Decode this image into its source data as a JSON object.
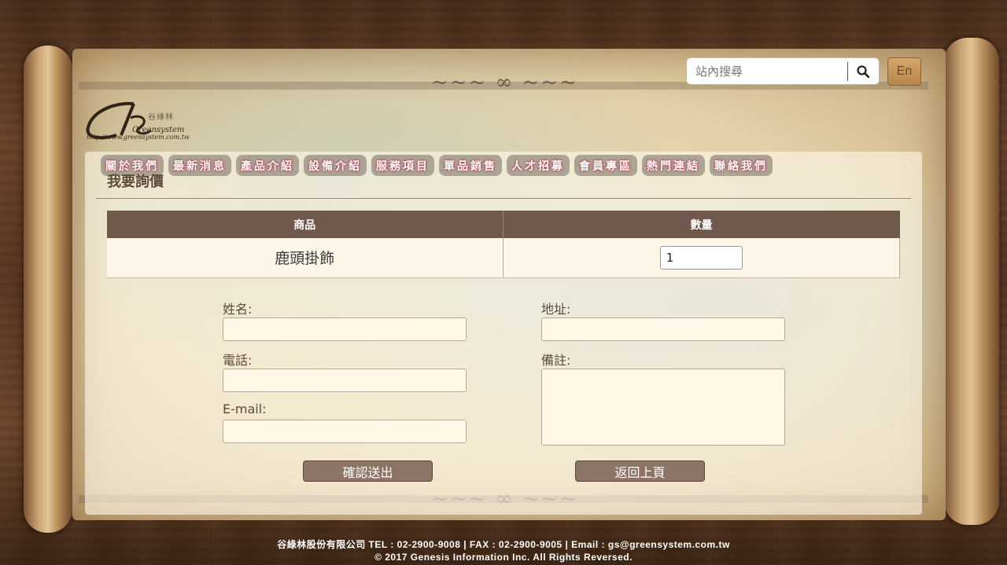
{
  "header": {
    "search_placeholder": "站內搜尋",
    "search_icon": "search-icon",
    "lang_label": "En",
    "logo": {
      "url_text": "http://www.greensystem.com.tw",
      "name_text": "Greensystem",
      "cn_text": "谷綠林"
    }
  },
  "nav": {
    "items": [
      "關於我們",
      "最新消息",
      "產品介紹",
      "設備介紹",
      "服務項目",
      "單品銷售",
      "人才招募",
      "會員專區",
      "熱門連結",
      "聯絡我們"
    ]
  },
  "page": {
    "title": "我要詢價"
  },
  "table": {
    "headers": [
      "商品",
      "數量"
    ],
    "rows": [
      {
        "product": "鹿頭掛飾",
        "quantity": "1"
      }
    ]
  },
  "form": {
    "name_label": "姓名:",
    "phone_label": "電話:",
    "email_label": "E-mail:",
    "address_label": "地址:",
    "note_label": "備註:",
    "submit_label": "確認送出",
    "back_label": "返回上頁"
  },
  "footer": {
    "line1": "谷綠林股份有限公司 TEL : 02-2900-9008 | FAX : 02-2900-9005 | Email : gs@greensystem.com.tw",
    "line2": "© 2017 Genesis Information Inc. All Rights Reversed."
  },
  "colors": {
    "nav_text_glow": "#b2344a",
    "table_header": "#6f584c",
    "button": "#8c7566"
  }
}
